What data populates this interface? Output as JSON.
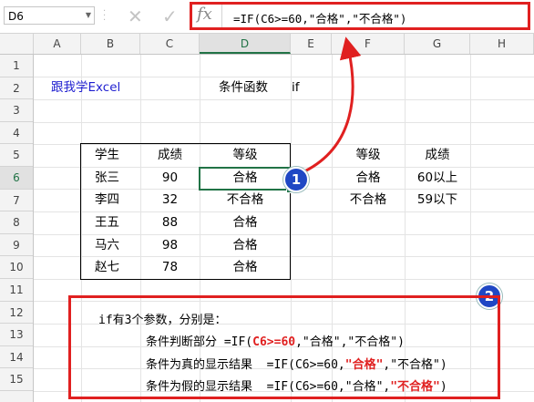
{
  "formula_bar": {
    "name_box": "D6",
    "fx": "fx",
    "formula": "=IF(C6>=60,\"合格\",\"不合格\")"
  },
  "columns": [
    "A",
    "B",
    "C",
    "D",
    "E",
    "F",
    "G",
    "H"
  ],
  "selected_column": "D",
  "rows": [
    "1",
    "2",
    "3",
    "4",
    "5",
    "6",
    "7",
    "8",
    "9",
    "10",
    "11",
    "12",
    "13",
    "14",
    "15"
  ],
  "selected_row": "6",
  "sheet": {
    "link_text": "跟我学Excel",
    "title": "条件函数",
    "title_suffix": "if",
    "table": {
      "headers": [
        "学生",
        "成绩",
        "等级"
      ],
      "rows": [
        [
          "张三",
          "90",
          "合格"
        ],
        [
          "李四",
          "32",
          "不合格"
        ],
        [
          "王五",
          "88",
          "合格"
        ],
        [
          "马六",
          "98",
          "合格"
        ],
        [
          "赵七",
          "78",
          "合格"
        ]
      ]
    },
    "legend": {
      "headers": [
        "等级",
        "成绩"
      ],
      "rows": [
        [
          "合格",
          "60以上"
        ],
        [
          "不合格",
          "59以下"
        ]
      ]
    }
  },
  "annotations": {
    "badge1": "1",
    "badge2": "2"
  },
  "notes": {
    "line1": "if有3个参数，分别是：",
    "line2_label": "条件判断部分 ",
    "line2_pre": "=IF(",
    "line2_red": "C6>=60",
    "line2_post": ",\"合格\",\"不合格\")",
    "line3_label": "条件为真的显示结果  ",
    "line3_pre": "=IF(C6>=60,",
    "line3_red": "\"合格\"",
    "line3_post": ",\"不合格\")",
    "line4_label": "条件为假的显示结果  ",
    "line4_pre": "=IF(C6>=60,\"合格\",",
    "line4_red": "\"不合格\"",
    "line4_post": ")"
  },
  "colors": {
    "highlight": "#e02020",
    "badge": "#1f47c4",
    "excel_green": "#217346",
    "link": "#1f1fd0"
  }
}
